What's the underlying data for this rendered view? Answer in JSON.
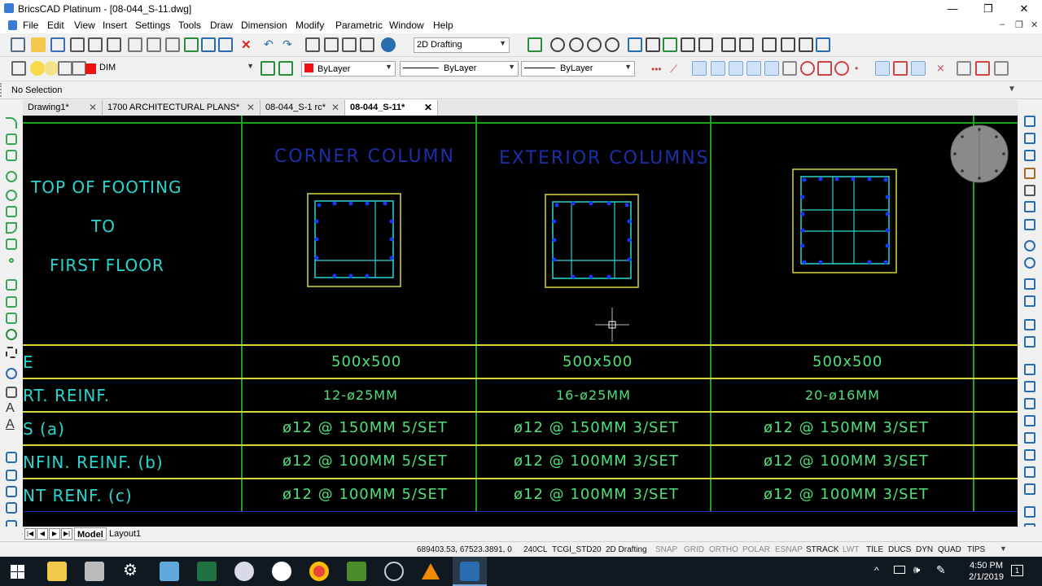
{
  "titlebar": {
    "title": "BricsCAD Platinum - [08-044_S-11.dwg]",
    "minimize": "—",
    "restore": "❐",
    "close": "✕"
  },
  "menubar": {
    "items": [
      "File",
      "Edit",
      "View",
      "Insert",
      "Settings",
      "Tools",
      "Draw",
      "Dimension",
      "Modify",
      "Parametric",
      "Window",
      "Help"
    ],
    "mdi_minimize": "–",
    "mdi_restore": "❐",
    "mdi_close": "✕"
  },
  "toolbar1": {
    "workspace": "2D Drafting"
  },
  "toolbar2": {
    "layer": "DIM",
    "color": "ByLayer",
    "linetype": "ByLayer",
    "lineweight": "ByLayer"
  },
  "selection": {
    "label": "No Selection"
  },
  "doc_tabs": [
    {
      "label": "Drawing1*",
      "active": false
    },
    {
      "label": "1700 ARCHITECTURAL PLANS*",
      "active": false
    },
    {
      "label": "08-044_S-1 rc*",
      "active": false
    },
    {
      "label": "08-044_S-11*",
      "active": true
    }
  ],
  "drawing": {
    "row_label": {
      "line1": "TOP OF FOOTING",
      "line2": "TO",
      "line3": "FIRST FLOOR"
    },
    "columns": [
      {
        "header": "CORNER COLUMN",
        "size": "500x500",
        "vert": "12-ø25MM",
        "ties_a": "ø12 @ 150MM 5/SET",
        "confin_b": "ø12 @ 100MM 5/SET",
        "joint_c": "ø12 @ 100MM 5/SET"
      },
      {
        "header": "EXTERIOR COLUMNS",
        "size": "500x500",
        "vert": "16-ø25MM",
        "ties_a": "ø12 @ 150MM 3/SET",
        "confin_b": "ø12 @ 100MM 3/SET",
        "joint_c": "ø12 @ 100MM 3/SET"
      },
      {
        "header": "",
        "size": "500x500",
        "vert": "20-ø16MM",
        "ties_a": "ø12 @ 150MM 3/SET",
        "confin_b": "ø12 @ 100MM 3/SET",
        "joint_c": "ø12 @ 100MM 3/SET"
      }
    ],
    "row_headers": {
      "size": "E",
      "vert": "RT. REINF.",
      "ties": "S   (a)",
      "confin": "NFIN. REINF.   (b)",
      "joint": "NT RENF.   (c)"
    }
  },
  "layout_tabs": {
    "model": "Model",
    "layout1": "Layout1"
  },
  "statusbar": {
    "coords": "689403.53, 67523.3891, 0",
    "items": [
      {
        "label": "240CL",
        "on": true
      },
      {
        "label": "TCGI_STD20",
        "on": true
      },
      {
        "label": "2D Drafting",
        "on": true
      },
      {
        "label": "SNAP",
        "on": false
      },
      {
        "label": "GRID",
        "on": false
      },
      {
        "label": "ORTHO",
        "on": false
      },
      {
        "label": "POLAR",
        "on": false
      },
      {
        "label": "ESNAP",
        "on": false
      },
      {
        "label": "STRACK",
        "on": true
      },
      {
        "label": "LWT",
        "on": false
      },
      {
        "label": "TILE",
        "on": true
      },
      {
        "label": "DUCS",
        "on": true
      },
      {
        "label": "DYN",
        "on": true
      },
      {
        "label": "QUAD",
        "on": true
      },
      {
        "label": "TIPS",
        "on": true
      }
    ]
  },
  "taskbar": {
    "time": "4:50 PM",
    "date": "2/1/2019",
    "notification_count": "1"
  },
  "colors": {
    "canvas_bg": "#000000",
    "cad_cyan": "#29d6cf",
    "cad_green": "#4fe07a",
    "cad_blue": "#1d2fa8",
    "grid_green": "#1fa41f",
    "grid_yellow": "#d6d63a"
  }
}
